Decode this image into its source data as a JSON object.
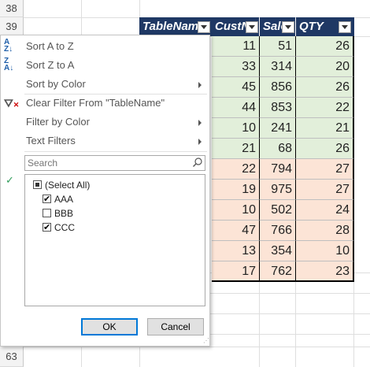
{
  "rows": {
    "top": "38",
    "header_row": "39",
    "bottom": "63"
  },
  "table": {
    "headers": [
      "TableName",
      "CustN",
      "Sale",
      "QTY"
    ],
    "rows": [
      {
        "custn": "11",
        "sale": "51",
        "qty": "26",
        "group": "green"
      },
      {
        "custn": "33",
        "sale": "314",
        "qty": "20",
        "group": "green"
      },
      {
        "custn": "45",
        "sale": "856",
        "qty": "26",
        "group": "green"
      },
      {
        "custn": "44",
        "sale": "853",
        "qty": "22",
        "group": "green"
      },
      {
        "custn": "10",
        "sale": "241",
        "qty": "21",
        "group": "green"
      },
      {
        "custn": "21",
        "sale": "68",
        "qty": "26",
        "group": "green"
      },
      {
        "custn": "22",
        "sale": "794",
        "qty": "27",
        "group": "peach"
      },
      {
        "custn": "19",
        "sale": "975",
        "qty": "27",
        "group": "peach"
      },
      {
        "custn": "10",
        "sale": "502",
        "qty": "24",
        "group": "peach"
      },
      {
        "custn": "47",
        "sale": "766",
        "qty": "28",
        "group": "peach"
      },
      {
        "custn": "13",
        "sale": "354",
        "qty": "10",
        "group": "peach"
      },
      {
        "custn": "17",
        "sale": "762",
        "qty": "23",
        "group": "peach"
      }
    ],
    "colors": {
      "header": "#1f3864",
      "green": "#e2efda",
      "peach": "#fce4d6"
    }
  },
  "menu": {
    "sort_az": "Sort A to Z",
    "sort_za": "Sort Z to A",
    "sort_color": "Sort by Color",
    "clear_filter": "Clear Filter From \"TableName\"",
    "filter_color": "Filter by Color",
    "text_filters": "Text Filters",
    "search_placeholder": "Search",
    "items": [
      {
        "label": "(Select All)",
        "state": "partial"
      },
      {
        "label": "AAA",
        "state": "checked"
      },
      {
        "label": "BBB",
        "state": "unchecked"
      },
      {
        "label": "CCC",
        "state": "checked"
      }
    ],
    "ok_label": "OK",
    "cancel_label": "Cancel"
  }
}
